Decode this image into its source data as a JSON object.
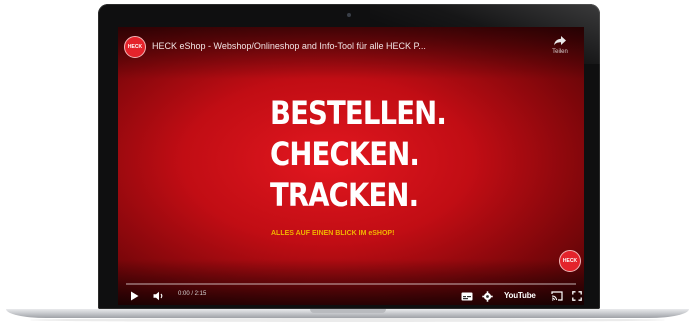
{
  "video": {
    "channel_logo_text": "HECK",
    "title": "HECK eShop - Webshop/Onlineshop and Info-Tool für alle HECK P...",
    "share_label": "Teilen",
    "headline": [
      "BESTELLEN.",
      "CHECKEN.",
      "TRACKEN."
    ],
    "subline": "ALLES AUF EINEN BLICK IM eSHOP!",
    "corner_badge_text": "HECK",
    "progress_fraction": 0.0,
    "time": "0:00 / 2:15",
    "player_brand": "YouTube"
  },
  "colors": {
    "screen_red": "#c10d14",
    "subline_yellow": "#f2b400",
    "progress_red": "#ff0000",
    "bezel": "#0f0f10"
  },
  "icons": {
    "share": "share-arrow-icon",
    "play": "play-icon",
    "volume": "volume-icon",
    "subtitles": "subtitles-icon",
    "settings": "gear-icon",
    "cast": "cast-icon",
    "fullscreen": "fullscreen-icon"
  }
}
